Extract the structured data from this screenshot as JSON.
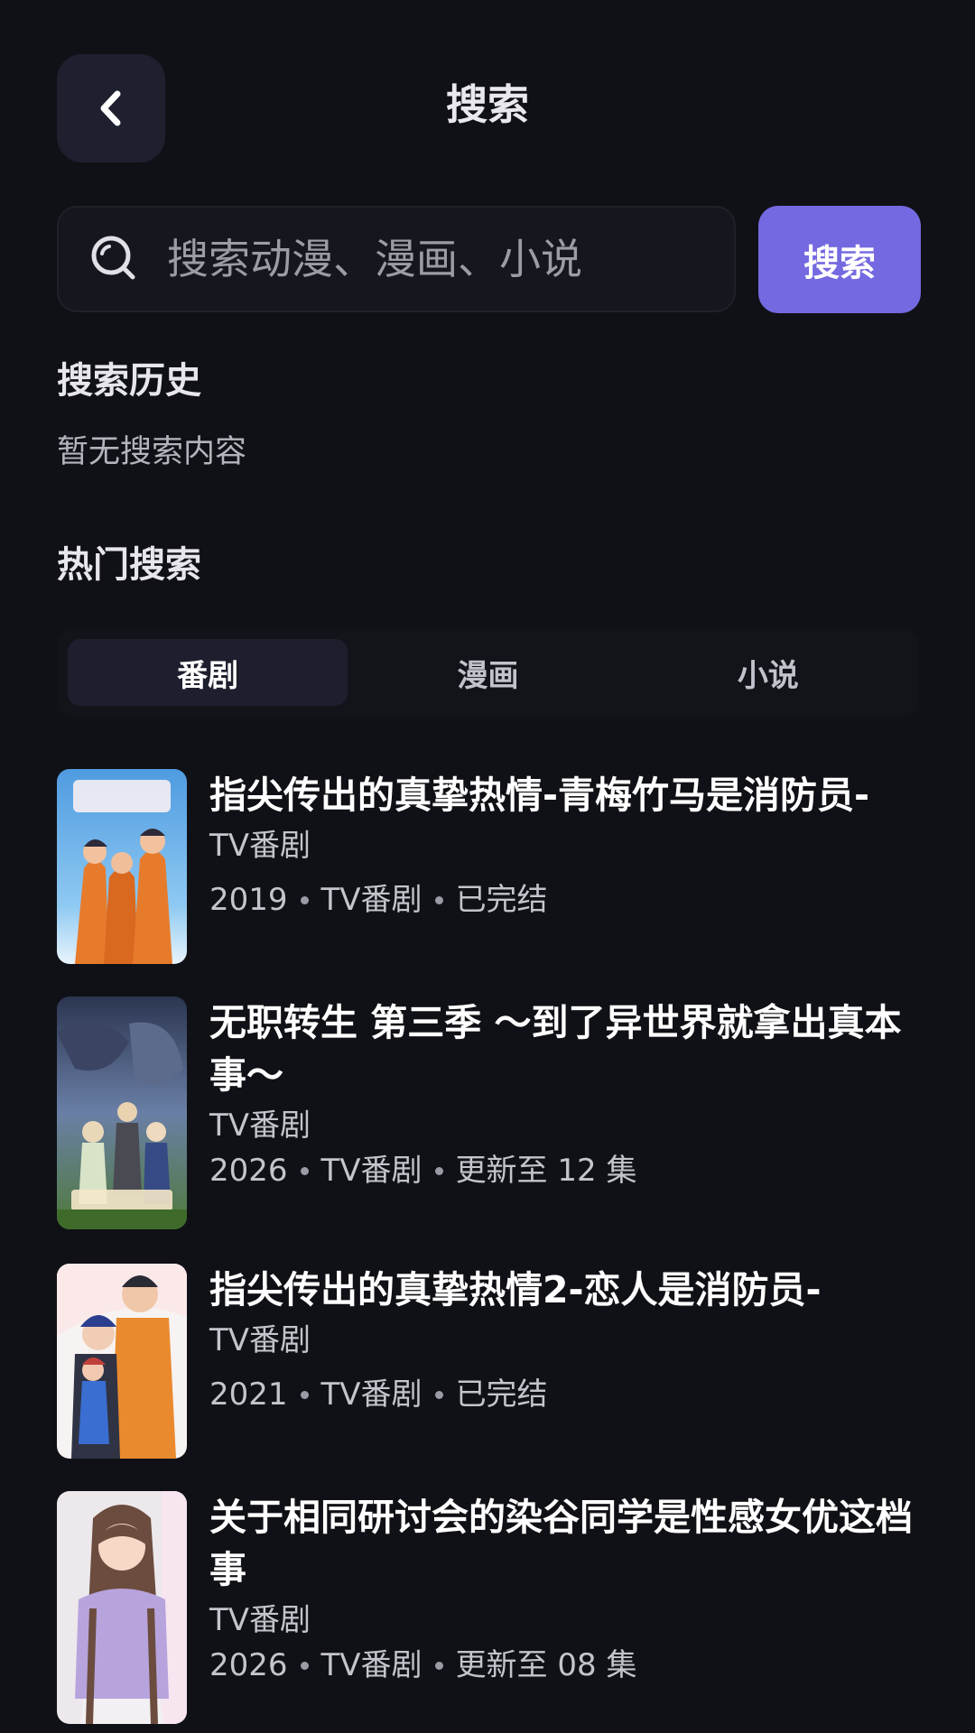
{
  "header": {
    "title": "搜索"
  },
  "search": {
    "placeholder": "搜索动漫、漫画、小说",
    "value": "",
    "button_label": "搜索"
  },
  "history": {
    "title": "搜索历史",
    "empty_text": "暂无搜索内容"
  },
  "hot": {
    "title": "热门搜索",
    "tabs": [
      {
        "label": "番剧",
        "active": true
      },
      {
        "label": "漫画",
        "active": false
      },
      {
        "label": "小说",
        "active": false
      }
    ],
    "results": [
      {
        "title": "指尖传出的真挚热情-青梅竹马是消防员-",
        "subtitle": "TV番剧",
        "year": "2019",
        "type": "TV番剧",
        "status": "已完结"
      },
      {
        "title": "无职转生 第三季 ～到了异世界就拿出真本事～",
        "subtitle": "TV番剧",
        "year": "2026",
        "type": "TV番剧",
        "status": "更新至 12 集"
      },
      {
        "title": "指尖传出的真挚热情2-恋人是消防员-",
        "subtitle": "TV番剧",
        "year": "2021",
        "type": "TV番剧",
        "status": "已完结"
      },
      {
        "title": "关于相同研讨会的染谷同学是性感女优这档事",
        "subtitle": "TV番剧",
        "year": "2026",
        "type": "TV番剧",
        "status": "更新至 08 集"
      }
    ]
  },
  "colors": {
    "background": "#101116",
    "accent": "#7469e0",
    "surface": "#1e2030"
  },
  "icons": {
    "back": "chevron-left-icon",
    "search": "search-icon"
  }
}
